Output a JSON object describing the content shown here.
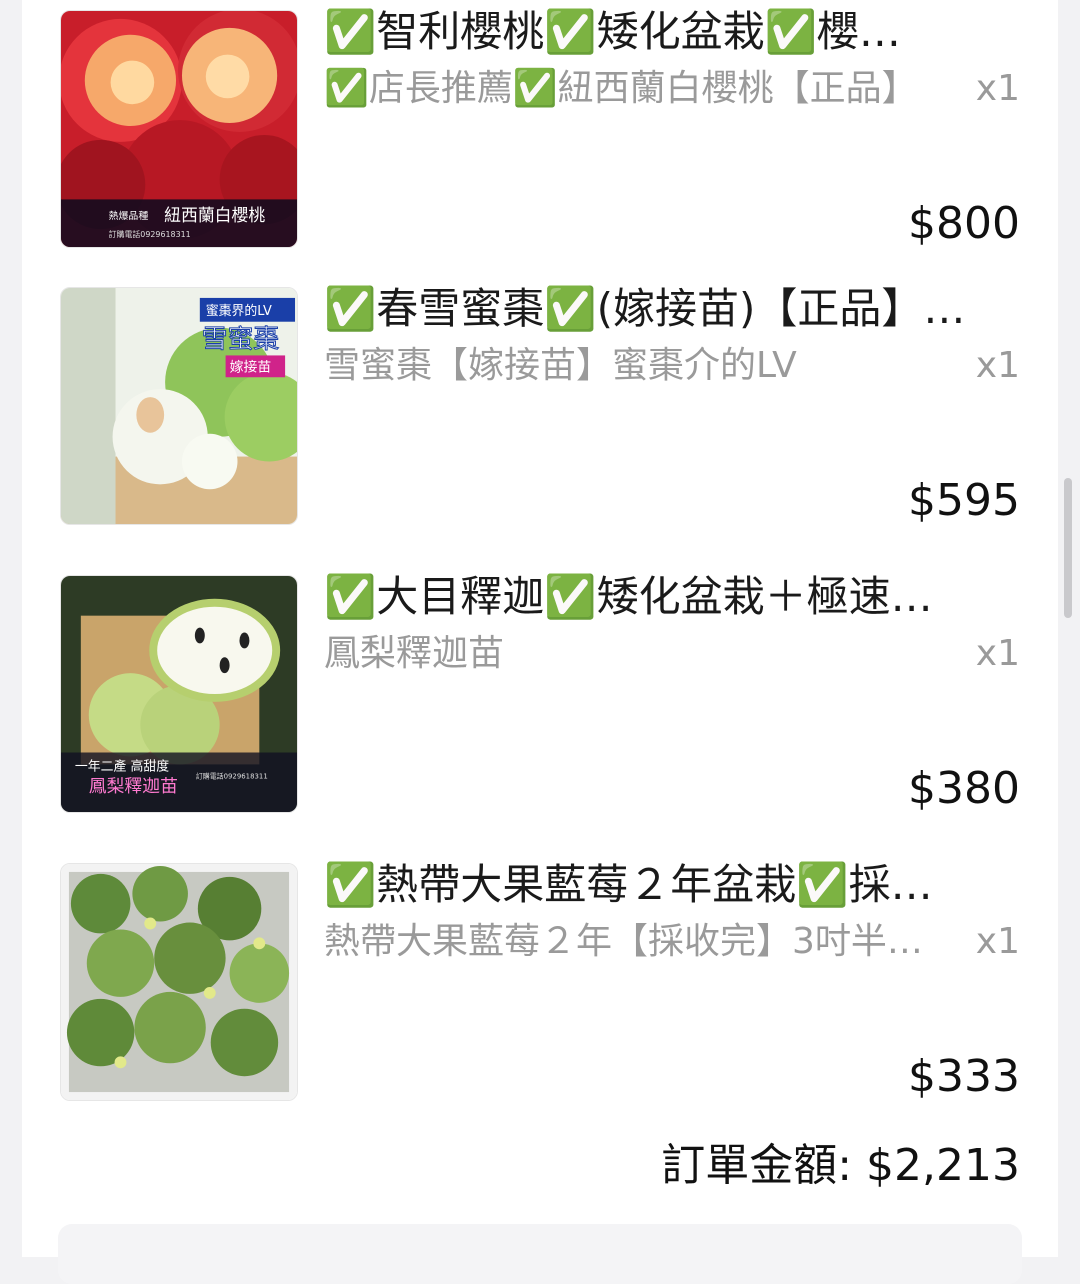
{
  "order": {
    "items": [
      {
        "title": "✅智利櫻桃✅矮化盆栽✅櫻…",
        "variant": "✅店長推薦✅紐西蘭白櫻桃【正品】",
        "qty": "x1",
        "price": "$800",
        "image_caption": "紐西蘭白櫻桃",
        "image_tag": "熱爆品種",
        "image_phone": "訂購電話0929618311"
      },
      {
        "title": "✅春雪蜜棗✅(嫁接苗)【正品】…",
        "variant": "雪蜜棗【嫁接苗】蜜棗介的LV",
        "qty": "x1",
        "price": "$595",
        "image_caption": "雪蜜棗",
        "image_tag": "蜜棗界的LV",
        "image_phone": "嫁接苗"
      },
      {
        "title": "✅大目釋迦✅矮化盆栽＋極速…",
        "variant": "鳳梨釋迦苗",
        "qty": "x1",
        "price": "$380",
        "image_caption": "鳳梨釋迦苗",
        "image_tag": "一年二產 高甜度",
        "image_phone": "訂購電話0929618311"
      },
      {
        "title": "✅熱帶大果藍莓２年盆栽✅採…",
        "variant": "熱帶大果藍莓２年【採收完】3吋半…",
        "qty": "x1",
        "price": "$333",
        "image_caption": "",
        "image_tag": "",
        "image_phone": ""
      }
    ],
    "total_label": "訂單金額:",
    "total_value": "$2,213"
  },
  "colors": {
    "background": "#f2f2f4",
    "card": "#ffffff",
    "text": "#1a1a1a",
    "muted": "#9a9a9a"
  }
}
